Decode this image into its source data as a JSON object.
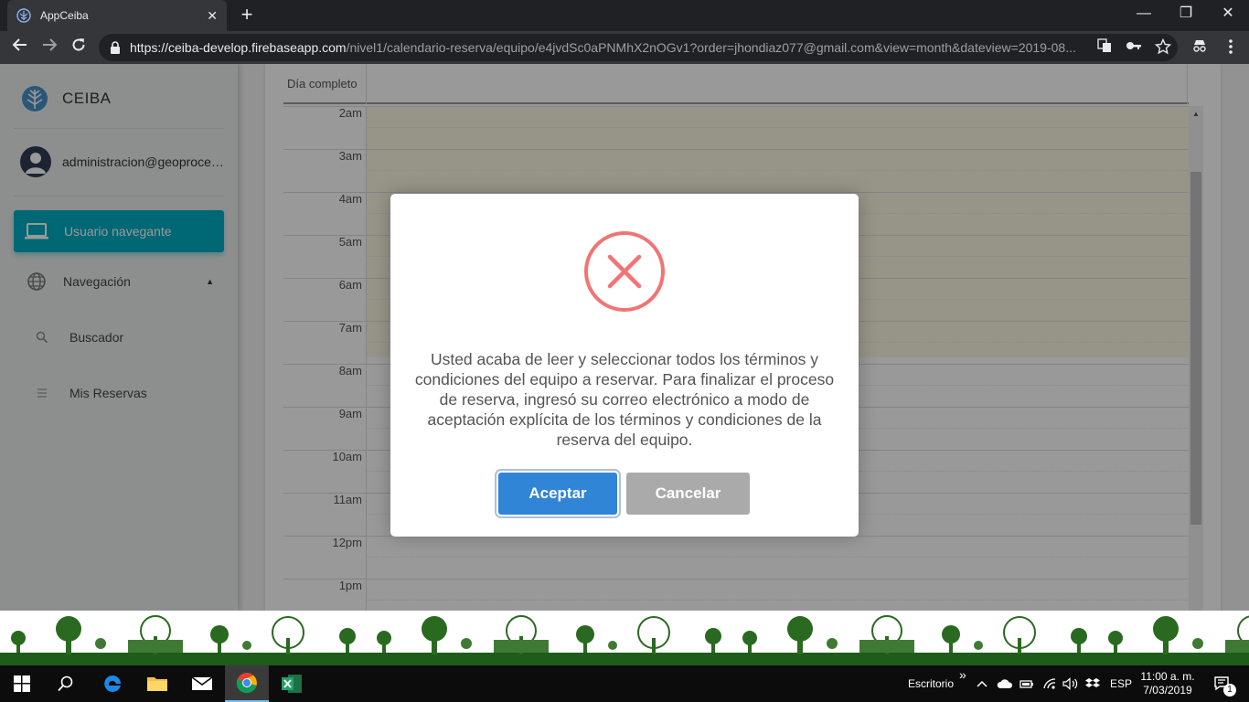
{
  "browser": {
    "tab_title": "AppCeiba",
    "tab_close": "✕",
    "new_tab": "+",
    "window_minimize": "—",
    "window_restore": "❐",
    "window_close": "✕",
    "url_host": "https://ceiba-develop.firebaseapp.com",
    "url_path": "/nivel1/calendario-reserva/equipo/e4jvdSc0aPNMhX2nOGv1?order=jhondiaz077@gmail.com&view=month&dateview=2019-08..."
  },
  "sidebar": {
    "brand": "CEIBA",
    "user_email": "administracion@geoprocesos.com",
    "items": [
      {
        "label": "Usuario navegante",
        "icon": "laptop-icon",
        "active": true
      },
      {
        "label": "Navegación",
        "icon": "globe-icon",
        "expanded": true
      },
      {
        "label": "Buscador",
        "icon": "search-icon"
      },
      {
        "label": "Mis Reservas",
        "icon": "list-icon"
      }
    ]
  },
  "calendar": {
    "allday_label": "Día completo",
    "hours": [
      "2am",
      "3am",
      "4am",
      "5am",
      "6am",
      "7am",
      "8am",
      "9am",
      "10am",
      "11am",
      "12pm",
      "1pm"
    ]
  },
  "modal": {
    "icon": "error-x-icon",
    "message": "Usted acaba de leer y seleccionar todos los términos y condiciones del equipo a reservar. Para finalizar el proceso de reserva, ingresó su correo electrónico a modo de aceptación explícita de los términos y condiciones de la reserva del equipo.",
    "confirm_label": "Aceptar",
    "cancel_label": "Cancelar",
    "confirm_color": "#3085d6",
    "cancel_color": "#aaaaaa",
    "icon_color": "#f27474"
  },
  "taskbar": {
    "desktop_label": "Escritorio",
    "chevron": "»",
    "language": "ESP",
    "time": "11:00 a. m.",
    "date": "7/03/2019",
    "notification_count": "1"
  },
  "colors": {
    "accent": "#00acc1"
  }
}
